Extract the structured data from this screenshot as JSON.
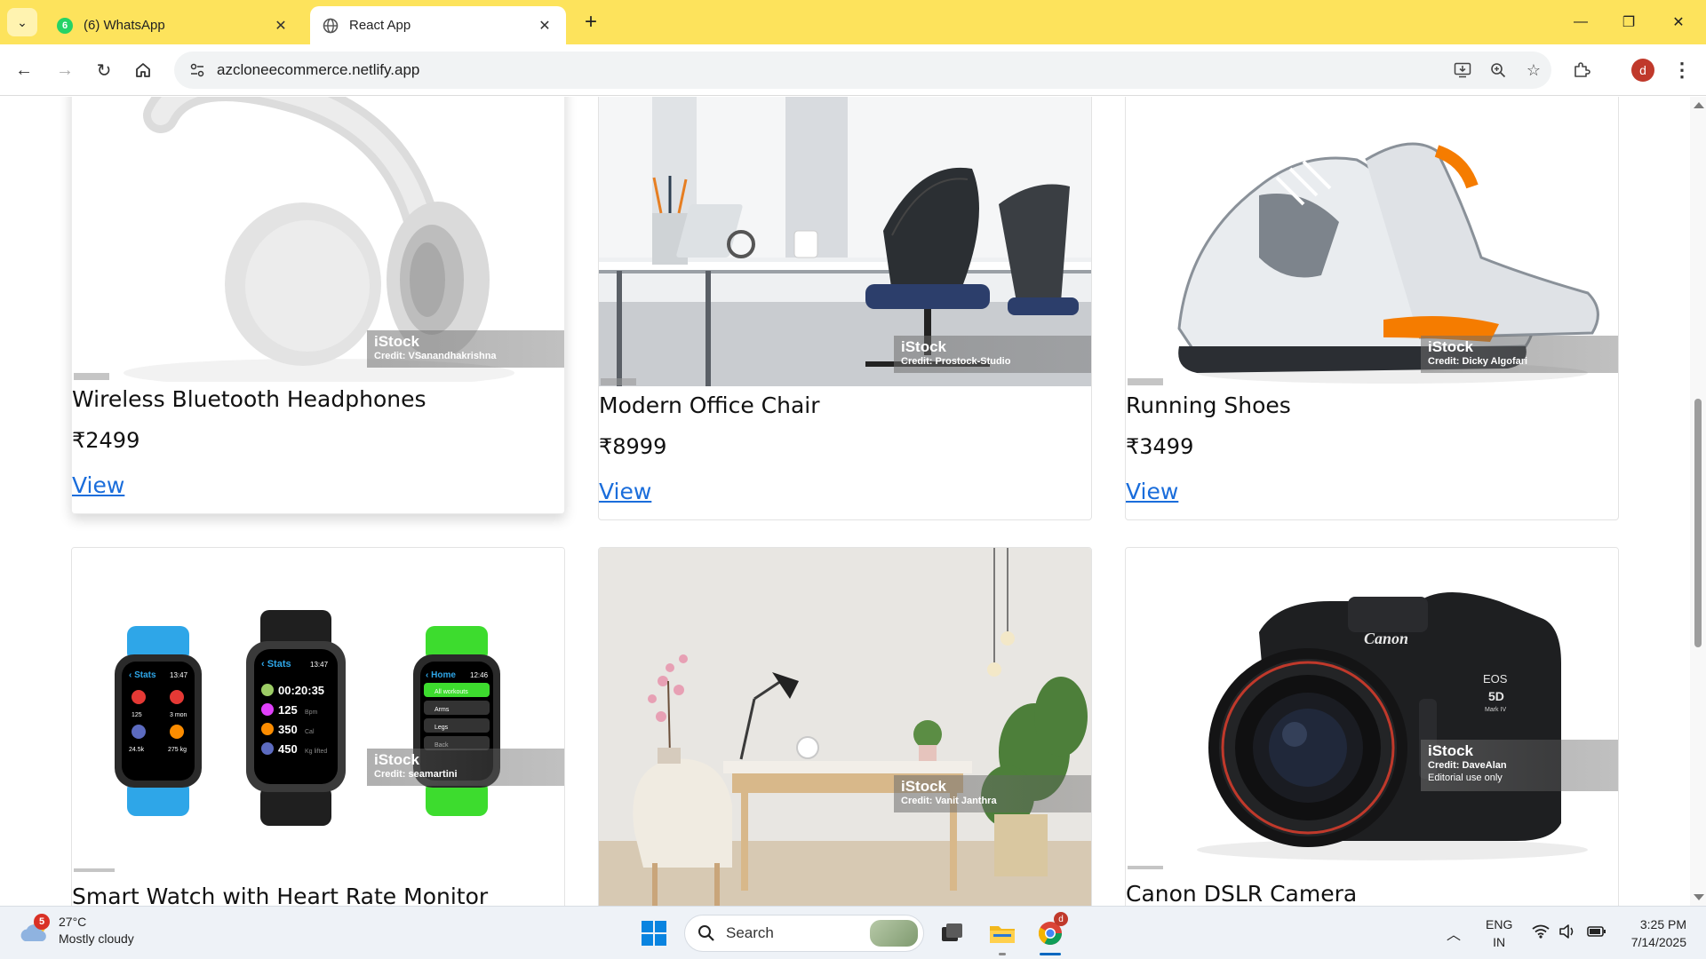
{
  "browser": {
    "tabs": [
      {
        "title": "(6) WhatsApp",
        "badge": "6",
        "active": false
      },
      {
        "title": "React App",
        "active": true
      }
    ],
    "url": "azcloneecommerce.netlify.app",
    "profile_initial": "d"
  },
  "products": [
    {
      "name": "Wireless Bluetooth Headphones",
      "price": "₹2499",
      "view_label": "View",
      "watermark": {
        "logo": "iStock",
        "credit": "Credit: VSanandhakrishna"
      },
      "image": "headphones"
    },
    {
      "name": "Modern Office Chair",
      "price": "₹8999",
      "view_label": "View",
      "watermark": {
        "logo": "iStock",
        "credit": "Credit: Prostock-Studio"
      },
      "image": "office-chair"
    },
    {
      "name": "Running Shoes",
      "price": "₹3499",
      "view_label": "View",
      "watermark": {
        "logo": "iStock",
        "credit": "Credit: Dicky Algofari"
      },
      "image": "running-shoes"
    },
    {
      "name": "Smart Watch with Heart Rate Monitor",
      "watermark": {
        "logo": "iStock",
        "credit": "Credit: seamartini"
      },
      "image": "smart-watches"
    },
    {
      "name": "",
      "watermark": {
        "logo": "iStock",
        "credit": "Credit: Vanit Janthra"
      },
      "image": "desk-room"
    },
    {
      "name": "Canon DSLR Camera",
      "watermark": {
        "logo": "iStock",
        "credit": "Credit: DaveAlan",
        "extra": "Editorial use only"
      },
      "image": "dslr-camera"
    }
  ],
  "watch_screens": {
    "left": {
      "title": "‹ Stats",
      "time": "13:47",
      "stats": [
        "125",
        "3 mon",
        "24.5k",
        "275 kg"
      ]
    },
    "middle": {
      "title": "‹ Stats",
      "time": "13:47",
      "rows": [
        "00:20:35",
        "125",
        "350",
        "450"
      ],
      "units": [
        "",
        "Bpm",
        "Cal",
        "Kg lifted"
      ]
    },
    "right": {
      "title": "‹ Home",
      "time": "12:46",
      "items": [
        "All workouts",
        "Arms",
        "Legs",
        "Back"
      ]
    }
  },
  "camera_labels": {
    "brand": "Canon",
    "model": "EOS",
    "model2": "5D",
    "mark": "Mark IV"
  },
  "taskbar": {
    "weather_temp": "27°C",
    "weather_desc": "Mostly cloudy",
    "weather_badge": "5",
    "search_label": "Search",
    "lang_line1": "ENG",
    "lang_line2": "IN",
    "time": "3:25 PM",
    "date": "7/14/2025",
    "chrome_badge": "d"
  },
  "colors": {
    "tabbar": "#fde35c",
    "link": "#1a6ddb",
    "accent": "#0067c0"
  }
}
